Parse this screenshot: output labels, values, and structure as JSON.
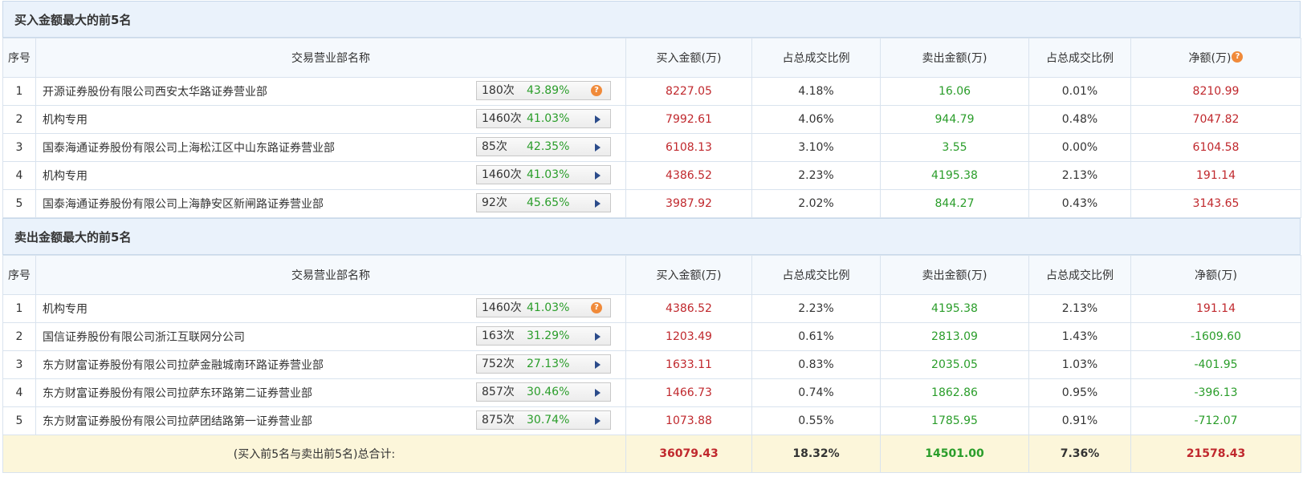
{
  "buy_section": {
    "title": "买入金额最大的前5名",
    "headers": [
      "序号",
      "交易营业部名称",
      "买入金额(万)",
      "占总成交比例",
      "卖出金额(万)",
      "占总成交比例",
      "净额(万)"
    ],
    "rows": [
      {
        "idx": "1",
        "name": "开源证券股份有限公司西安太华路证券营业部",
        "count": "180次",
        "rate": "43.89%",
        "icon": "question-icon",
        "buy": "8227.05",
        "buy_pct": "4.18%",
        "sell": "16.06",
        "sell_pct": "0.01%",
        "net": "8210.99"
      },
      {
        "idx": "2",
        "name": "机构专用",
        "count": "1460次",
        "rate": "41.03%",
        "icon": "play-arrow-icon",
        "buy": "7992.61",
        "buy_pct": "4.06%",
        "sell": "944.79",
        "sell_pct": "0.48%",
        "net": "7047.82"
      },
      {
        "idx": "3",
        "name": "国泰海通证券股份有限公司上海松江区中山东路证券营业部",
        "count": "85次",
        "rate": "42.35%",
        "icon": "play-arrow-icon",
        "buy": "6108.13",
        "buy_pct": "3.10%",
        "sell": "3.55",
        "sell_pct": "0.00%",
        "net": "6104.58"
      },
      {
        "idx": "4",
        "name": "机构专用",
        "count": "1460次",
        "rate": "41.03%",
        "icon": "play-arrow-icon",
        "buy": "4386.52",
        "buy_pct": "2.23%",
        "sell": "4195.38",
        "sell_pct": "2.13%",
        "net": "191.14"
      },
      {
        "idx": "5",
        "name": "国泰海通证券股份有限公司上海静安区新闸路证券营业部",
        "count": "92次",
        "rate": "45.65%",
        "icon": "play-arrow-icon",
        "buy": "3987.92",
        "buy_pct": "2.02%",
        "sell": "844.27",
        "sell_pct": "0.43%",
        "net": "3143.65"
      }
    ]
  },
  "sell_section": {
    "title": "卖出金额最大的前5名",
    "headers": [
      "序号",
      "交易营业部名称",
      "买入金额(万)",
      "占总成交比例",
      "卖出金额(万)",
      "占总成交比例",
      "净额(万)"
    ],
    "rows": [
      {
        "idx": "1",
        "name": "机构专用",
        "count": "1460次",
        "rate": "41.03%",
        "icon": "question-icon",
        "buy": "4386.52",
        "buy_pct": "2.23%",
        "sell": "4195.38",
        "sell_pct": "2.13%",
        "net": "191.14"
      },
      {
        "idx": "2",
        "name": "国信证券股份有限公司浙江互联网分公司",
        "count": "163次",
        "rate": "31.29%",
        "icon": "play-arrow-icon",
        "buy": "1203.49",
        "buy_pct": "0.61%",
        "sell": "2813.09",
        "sell_pct": "1.43%",
        "net": "-1609.60"
      },
      {
        "idx": "3",
        "name": "东方财富证券股份有限公司拉萨金融城南环路证券营业部",
        "count": "752次",
        "rate": "27.13%",
        "icon": "play-arrow-icon",
        "buy": "1633.11",
        "buy_pct": "0.83%",
        "sell": "2035.05",
        "sell_pct": "1.03%",
        "net": "-401.95"
      },
      {
        "idx": "4",
        "name": "东方财富证券股份有限公司拉萨东环路第二证券营业部",
        "count": "857次",
        "rate": "30.46%",
        "icon": "play-arrow-icon",
        "buy": "1466.73",
        "buy_pct": "0.74%",
        "sell": "1862.86",
        "sell_pct": "0.95%",
        "net": "-396.13"
      },
      {
        "idx": "5",
        "name": "东方财富证券股份有限公司拉萨团结路第一证券营业部",
        "count": "875次",
        "rate": "30.74%",
        "icon": "play-arrow-icon",
        "buy": "1073.88",
        "buy_pct": "0.55%",
        "sell": "1785.95",
        "sell_pct": "0.91%",
        "net": "-712.07"
      }
    ]
  },
  "total": {
    "label": "(买入前5名与卖出前5名)总合计:",
    "buy": "36079.43",
    "buy_pct": "18.32%",
    "sell": "14501.00",
    "sell_pct": "7.36%",
    "net": "21578.43"
  },
  "colors": {
    "red": "#c0282d",
    "green": "#2a9d2a",
    "header_bg": "#eaf2fb",
    "total_bg": "#fcf6da"
  }
}
